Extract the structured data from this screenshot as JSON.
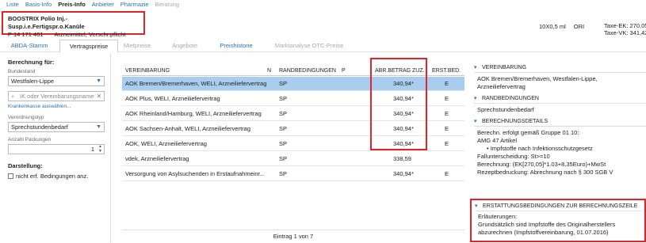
{
  "topnav": [
    "Liste",
    "Basis-Info",
    "Preis-Info",
    "Anbieter",
    "Pharmazie",
    "Beratung"
  ],
  "product": {
    "name": "BOOSTRIX Polio Inj.-Susp.i.e.Fertigspr.o.Kanüle",
    "pzn": "P 14 171 461",
    "category": "Arzneimittel, Verschr.pflicht",
    "pack": "10X0,5 ml",
    "origin": "ORI",
    "tax_ek": "Taxe-EK: 270,05",
    "tax_vk": "Taxe-VK: 341,42"
  },
  "tabs": [
    "ABDA-Stamm",
    "Vertragspreise",
    "Mietpreise",
    "Angebote",
    "Preishistorie",
    "Marktanalyse OTC-Preise"
  ],
  "left": {
    "berechnung_label": "Berechnung für:",
    "bundesland_label": "Bundesland",
    "bundesland_value": "Westfalen-Lippe",
    "search_placeholder": "IK oder Vereinbarungsname",
    "link": "Krankenkasse auswählen...",
    "verordnungstyp_label": "Verordnungstyp",
    "verordnungstyp_value": "Sprechstundenbedarf",
    "packungen_label": "Anzahl Packungen",
    "packungen_value": "1",
    "darstellung_label": "Darstellung:",
    "checkbox_label": "nicht erf. Bedingungen anz."
  },
  "table": {
    "headers": {
      "vereinbarung": "VEREINBARUNG",
      "n": "N",
      "rand": "RANDBEDINGUNGEN",
      "p": "P",
      "betrag": "ABR.BETRAG",
      "zuz": "ZUZ.",
      "erst": "ERST.BED."
    },
    "rows": [
      {
        "name": "AOK Bremen/Bremerhaven, WELI, Arzneiliefervertrag",
        "rand": "SP",
        "betrag": "340,94*",
        "erst": "E"
      },
      {
        "name": "AOK Plus, WELI, Arzneiliefervertrag",
        "rand": "SP",
        "betrag": "340,94*",
        "erst": "E"
      },
      {
        "name": "AOK Rheinland/Hamburg, WELI, Arzneiliefervertrag",
        "rand": "SP",
        "betrag": "340,94*",
        "erst": "E"
      },
      {
        "name": "AOK Sachsen-Anhalt, WELI, Arzneiliefervertrag",
        "rand": "SP",
        "betrag": "340,94*",
        "erst": "E"
      },
      {
        "name": "AOK, WELI, Arzneiliefervertrag",
        "rand": "SP",
        "betrag": "340,94*",
        "erst": "E"
      },
      {
        "name": "vdek, Arzneiliefervertrag",
        "rand": "SP",
        "betrag": "338,59",
        "erst": ""
      },
      {
        "name": "Versorgung von Asylsuchenden in Erstaufnahmeinr...",
        "rand": "SP",
        "betrag": "340,94*",
        "erst": "E"
      }
    ],
    "pager": "Eintrag 1 von 7"
  },
  "right": {
    "sec1": "VEREINBARUNG",
    "sec1_body": "AOK Bremen/Bremerhaven, Westfalen-Lippe, Arzneiliefervertrag",
    "sec2": "RANDBEDINGUNGEN",
    "sec2_body": "Sprechstundenbedarf",
    "sec3": "BERECHNUNGSDETAILS",
    "sec3_l1": "Berechn. erfolgt gemäß Gruppe 01 10:",
    "sec3_l2": "AMG 47 Artikel",
    "sec3_l3": "• Impfstoffe nach Infektionsschutzgesetz",
    "sec3_l4": "Fallunterscheidung: St>=10",
    "sec3_l5": "Berechnung: (EK[270,05]*1.03+8,35Euro)+MwSt",
    "sec3_l6": "Rezeptbedruckung: Abrechnung nach § 300 SGB V",
    "sec4": "ERSTATTUNGSBEDINGUNGEN ZUR BERECHNUNGSZEILE",
    "sec4_l1": "Erläuterungen:",
    "sec4_l2": "Grundsätzlich sind Impfstoffe des Originalherstellers abzurechnen (Impfstoffvereinbarung, 01.07.2016)"
  },
  "colors": {
    "accent": "#2a73b5",
    "highlight": "#e0242b",
    "selected_row": "#a8cdee"
  }
}
